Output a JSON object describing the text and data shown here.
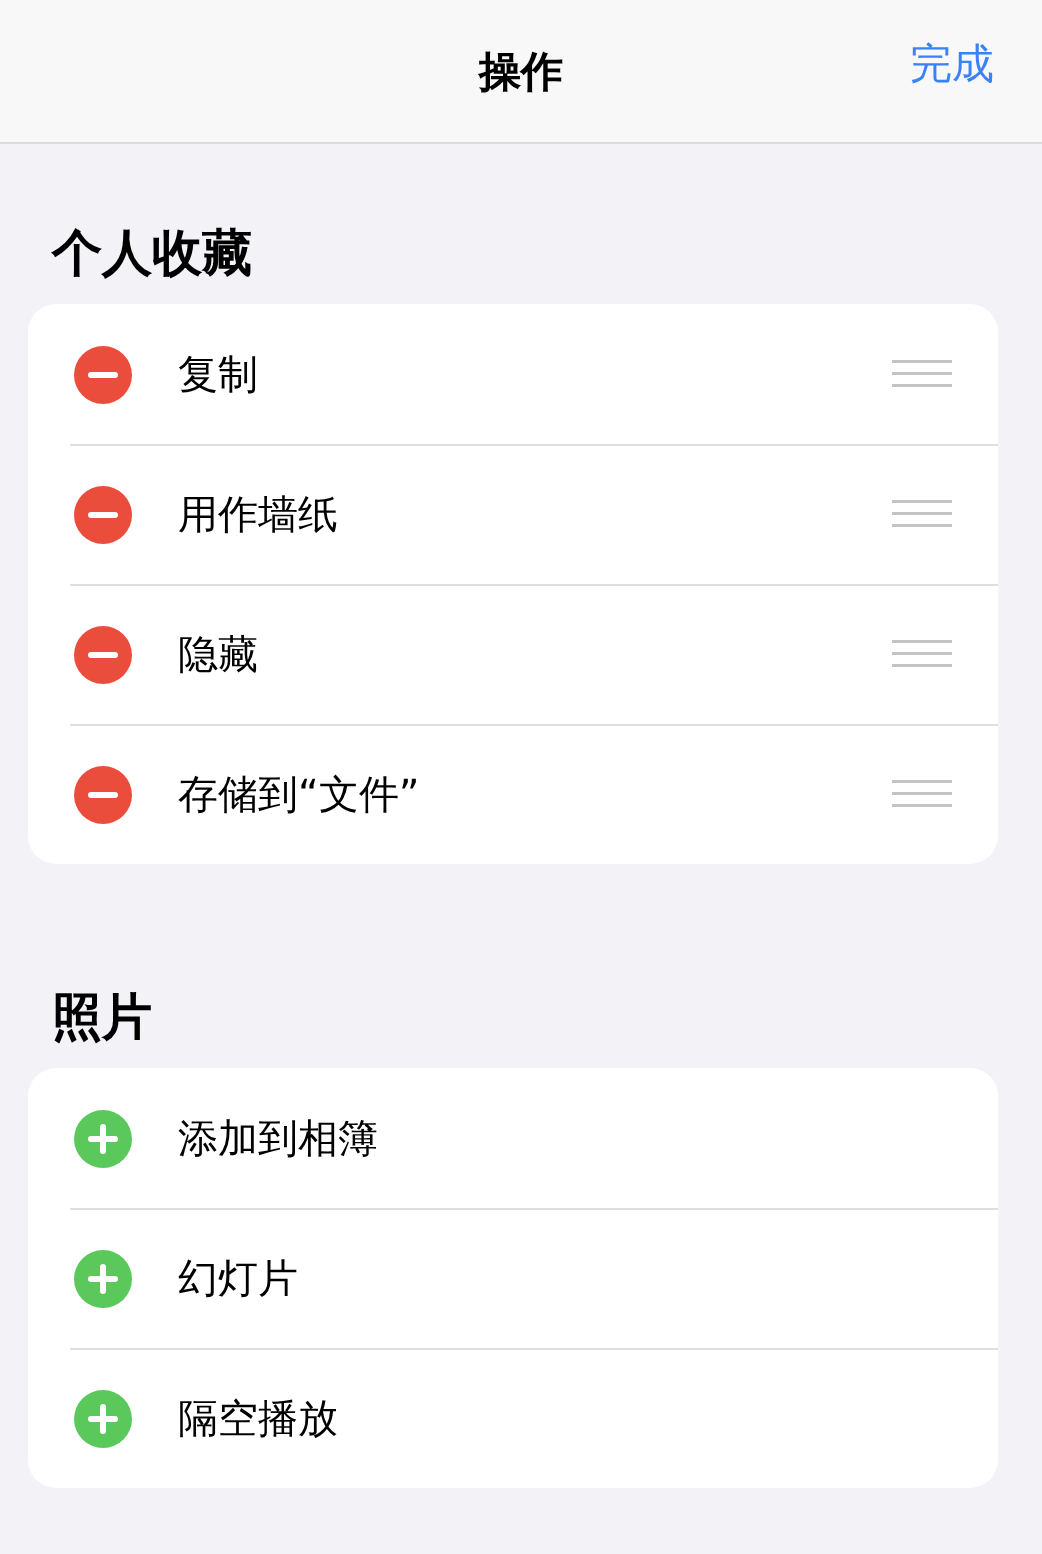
{
  "header": {
    "title": "操作",
    "done": "完成"
  },
  "sections": [
    {
      "title": "个人收藏",
      "items": [
        {
          "label": "复制",
          "kind": "remove",
          "reorderable": true
        },
        {
          "label": "用作墙纸",
          "kind": "remove",
          "reorderable": true
        },
        {
          "label": "隐藏",
          "kind": "remove",
          "reorderable": true
        },
        {
          "label": "存储到“文件”",
          "kind": "remove",
          "reorderable": true
        }
      ]
    },
    {
      "title": "照片",
      "items": [
        {
          "label": "添加到相簿",
          "kind": "add",
          "reorderable": false
        },
        {
          "label": "幻灯片",
          "kind": "add",
          "reorderable": false
        },
        {
          "label": "隔空播放",
          "kind": "add",
          "reorderable": false
        }
      ]
    }
  ]
}
